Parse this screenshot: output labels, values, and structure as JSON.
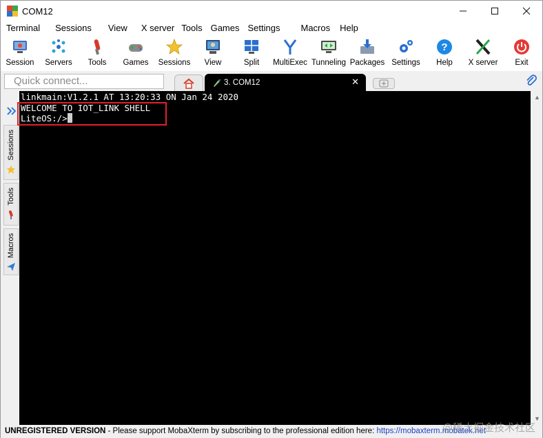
{
  "window": {
    "title": "COM12"
  },
  "menubar": [
    "Terminal",
    "Sessions",
    "View",
    "X server",
    "Tools",
    "Games",
    "Settings",
    "Macros",
    "Help"
  ],
  "toolbar": [
    {
      "label": "Session",
      "icon": "session-icon"
    },
    {
      "label": "Servers",
      "icon": "servers-icon"
    },
    {
      "label": "Tools",
      "icon": "tools-icon"
    },
    {
      "label": "Games",
      "icon": "games-icon"
    },
    {
      "label": "Sessions",
      "icon": "sessions-star-icon"
    },
    {
      "label": "View",
      "icon": "view-icon"
    },
    {
      "label": "Split",
      "icon": "split-icon"
    },
    {
      "label": "MultiExec",
      "icon": "multiexec-icon"
    },
    {
      "label": "Tunneling",
      "icon": "tunneling-icon"
    },
    {
      "label": "Packages",
      "icon": "packages-icon"
    },
    {
      "label": "Settings",
      "icon": "settings-gear-icon"
    },
    {
      "label": "Help",
      "icon": "help-icon"
    },
    {
      "label": "X server",
      "icon": "x-server-icon"
    },
    {
      "label": "Exit",
      "icon": "exit-power-icon"
    }
  ],
  "tabs": {
    "quick_connect_placeholder": "Quick connect...",
    "active_label": "3. COM12",
    "close_glyph": "✕"
  },
  "sidebar": {
    "sessions_label": "Sessions",
    "tools_label": "Tools",
    "macros_label": "Macros"
  },
  "terminal": {
    "lines": [
      "linkmain:V1.2.1 AT 13:20:33 ON Jan 24 2020",
      "WELCOME TO IOT_LINK SHELL",
      "LiteOS:/>"
    ]
  },
  "status": {
    "unregistered": "UNREGISTERED VERSION",
    "message": "  -  Please support MobaXterm by subscribing to the professional edition here:  ",
    "link": "https://mobaxterm.mobatek.net"
  },
  "watermark": "@稀土掘金技术社区",
  "colors": {
    "highlight": "#e3202a",
    "link": "#1c3fc8",
    "terminal_bg": "#000000"
  }
}
